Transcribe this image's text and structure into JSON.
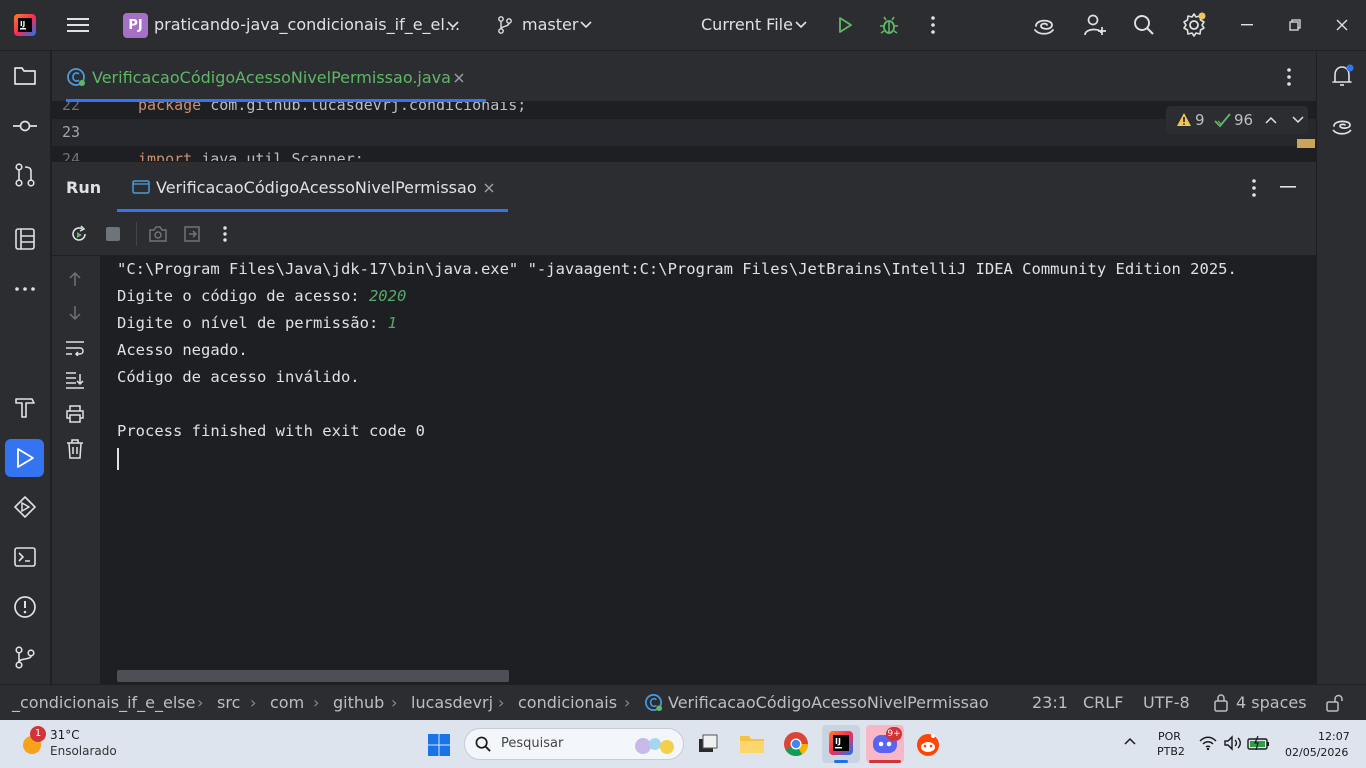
{
  "titlebar": {
    "project_badge": "PJ",
    "project_name": "praticando-java_condicionais_if_e_el...",
    "branch": "master",
    "run_config": "Current File"
  },
  "editor": {
    "tab_label": "VerificacaoCódigoAcessoNivelPermissao.java",
    "lines": [
      {
        "num": "22",
        "keyword": "package",
        "rest": " com.github.lucasdevrj.condicionais;"
      },
      {
        "num": "23",
        "keyword": "",
        "rest": ""
      },
      {
        "num": "24",
        "keyword": "import",
        "rest": " java.util.Scanner;"
      }
    ],
    "warnings": "9",
    "checks": "96"
  },
  "run_panel": {
    "title": "Run",
    "tab_label": "VerificacaoCódigoAcessoNivelPermissao",
    "console": {
      "command": "\"C:\\Program Files\\Java\\jdk-17\\bin\\java.exe\" \"-javaagent:C:\\Program Files\\JetBrains\\IntelliJ IDEA Community Edition 2025.",
      "prompt_code": "Digite o código de acesso: ",
      "input_code": "2020",
      "prompt_level": "Digite o nível de permissão: ",
      "input_level": "1",
      "line_denied": "Acesso negado.",
      "line_invalid": "Código de acesso inválido.",
      "line_exit": "Process finished with exit code 0"
    }
  },
  "statusbar": {
    "breadcrumbs": [
      "_condicionais_if_e_else",
      "src",
      "com",
      "github",
      "lucasdevrj",
      "condicionais",
      "VerificacaoCódigoAcessoNivelPermissao"
    ],
    "position": "23:1",
    "line_ending": "CRLF",
    "encoding": "UTF-8",
    "indent": "4 spaces"
  },
  "taskbar": {
    "weather_badge": "1",
    "temperature": "31°C",
    "weather_desc": "Ensolarado",
    "search_placeholder": "Pesquisar",
    "discord_badge": "9+",
    "lang_line1": "POR",
    "lang_line2": "PTB2",
    "time": "12:07",
    "date": "02/05/2026"
  },
  "colors": {
    "accent": "#3574f0",
    "keyword": "#cf8e6d",
    "user_input": "#56a86b",
    "run_green": "#5fb865",
    "warning": "#f2c55c"
  }
}
